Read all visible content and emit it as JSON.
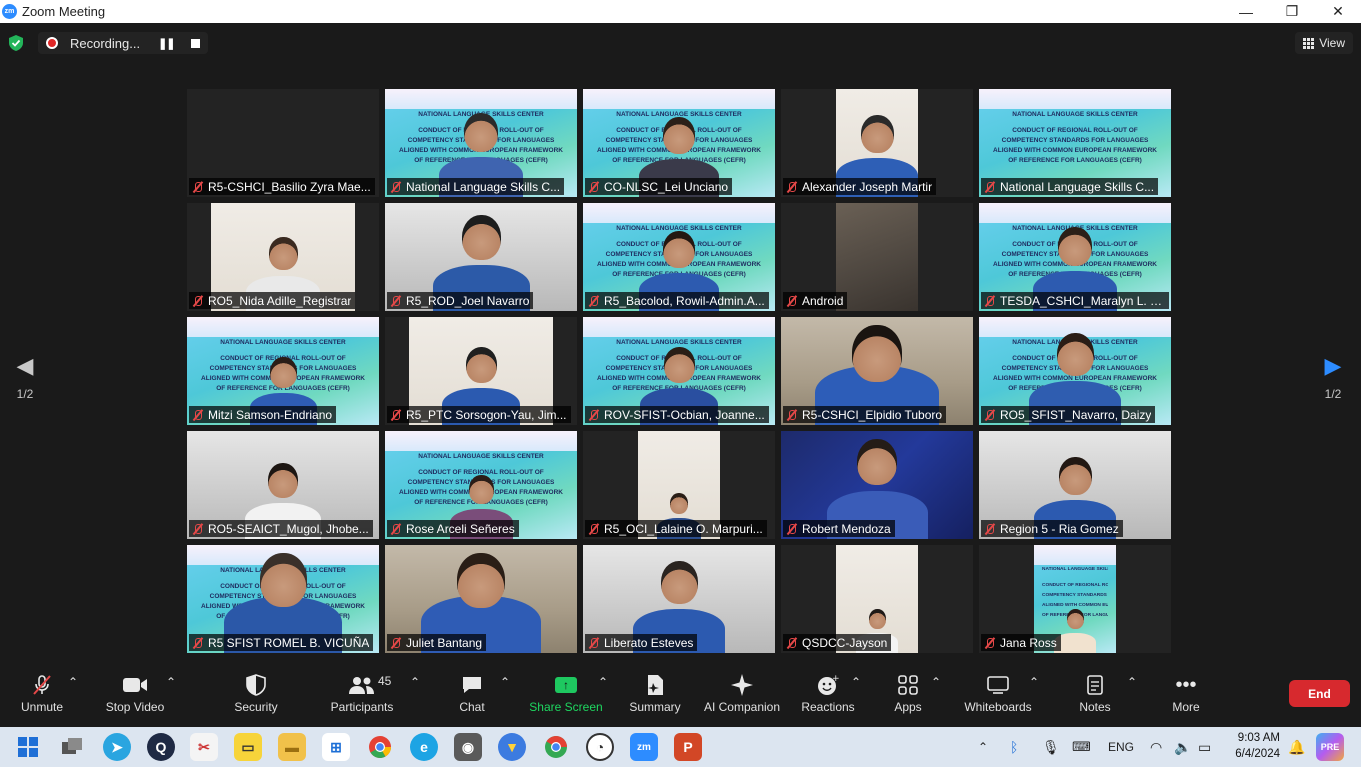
{
  "window": {
    "title": "Zoom Meeting",
    "minimize": "—",
    "maximize": "❐",
    "close": "✕"
  },
  "topbar": {
    "recording_label": "Recording...",
    "view_label": "View"
  },
  "pager": {
    "left_page": "1/2",
    "right_page": "1/2"
  },
  "banner": {
    "center": "NATIONAL LANGUAGE SKILLS CENTER",
    "line1": "CONDUCT OF REGIONAL ROLL-OUT OF",
    "line2": "COMPETENCY STANDARDS FOR LANGUAGES",
    "line3": "ALIGNED WITH COMMON EUROPEAN FRAMEWORK",
    "line4": "OF REFERENCE FOR LANGUAGES (CEFR)"
  },
  "participants": [
    {
      "name": "R5-CSHCI_Basilio Zyra Mae..."
    },
    {
      "name": "National Language Skills C..."
    },
    {
      "name": "CO-NLSC_Lei Unciano"
    },
    {
      "name": "Alexander Joseph Martir"
    },
    {
      "name": "National Language Skills C..."
    },
    {
      "name": "RO5_Nida Adille_Registrar"
    },
    {
      "name": "R5_ROD_Joel Navarro"
    },
    {
      "name": "R5_Bacolod, Rowil-Admin.A..."
    },
    {
      "name": "Android"
    },
    {
      "name": "TESDA_CSHCI_Maralyn L. B..."
    },
    {
      "name": "Mitzi Samson-Endriano"
    },
    {
      "name": "R5_PTC Sorsogon-Yau, Jim..."
    },
    {
      "name": "ROV-SFIST-Ocbian, Joanne..."
    },
    {
      "name": "R5-CSHCI_Elpidio Tuboro"
    },
    {
      "name": "RO5_SFIST_Navarro, Daizy"
    },
    {
      "name": "RO5-SEAICT_Mugol, Jhobe..."
    },
    {
      "name": "Rose Arceli Señeres"
    },
    {
      "name": "R5_OCI_Lalaine O. Marpuri..."
    },
    {
      "name": "Robert Mendoza"
    },
    {
      "name": "Region 5 - Ria Gomez"
    },
    {
      "name": "R5 SFIST ROMEL B. VICUÑA"
    },
    {
      "name": "Juliet Bantang"
    },
    {
      "name": "Liberato Esteves"
    },
    {
      "name": "QSDCC-Jayson"
    },
    {
      "name": "Jana Ross"
    }
  ],
  "toolbar": {
    "unmute": "Unmute",
    "stop_video": "Stop Video",
    "security": "Security",
    "participants": "Participants",
    "participants_count": "45",
    "chat": "Chat",
    "share_screen": "Share Screen",
    "summary": "Summary",
    "ai_companion": "AI Companion",
    "reactions": "Reactions",
    "apps": "Apps",
    "whiteboards": "Whiteboards",
    "notes": "Notes",
    "more": "More",
    "end": "End"
  },
  "taskbar": {
    "language": "ENG",
    "time": "9:03 AM",
    "date": "6/4/2024"
  },
  "colors": {
    "accent": "#2d8cff",
    "end": "#d7292e",
    "share": "#1ed760",
    "active_speaker": "#ece27c",
    "muted": "#e54848"
  }
}
